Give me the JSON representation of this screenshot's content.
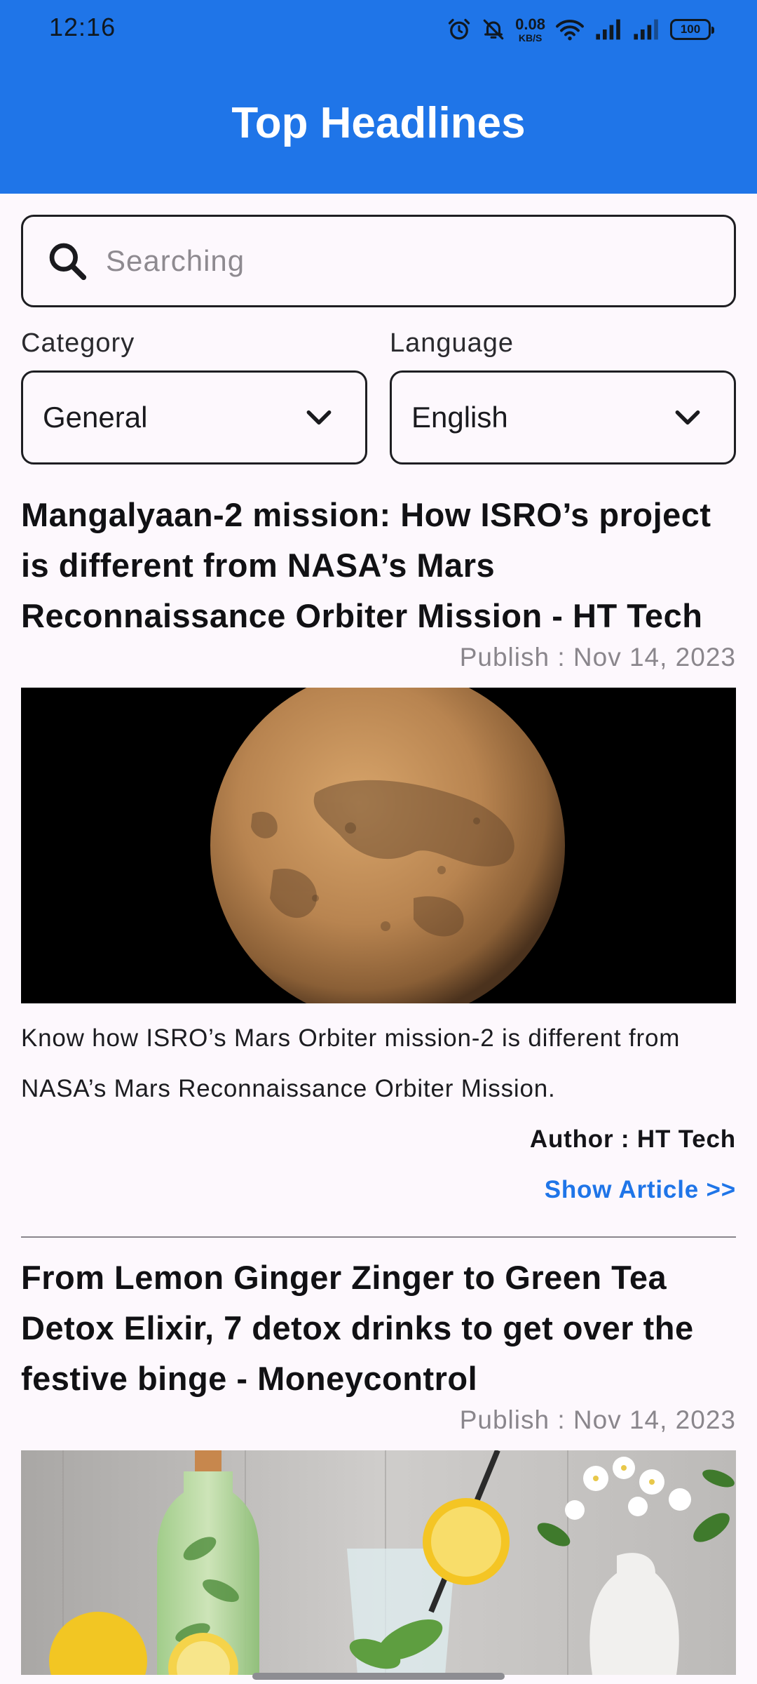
{
  "status_bar": {
    "time": "12:16",
    "net_speed_value": "0.08",
    "net_speed_unit": "KB/S",
    "battery": "100",
    "icons": [
      "alarm-icon",
      "mute-icon",
      "wifi-icon",
      "signal-icon",
      "signal-icon",
      "battery-icon"
    ]
  },
  "app_bar": {
    "title": "Top Headlines",
    "color": "#1f75e8"
  },
  "search": {
    "placeholder": "Searching",
    "value": ""
  },
  "filters": {
    "category_label": "Category",
    "category_value": "General",
    "language_label": "Language",
    "language_value": "English"
  },
  "articles": [
    {
      "title": "Mangalyaan-2 mission: How ISRO’s project is different from NASA’s Mars Reconnaissance Orbiter Mission - HT Tech",
      "publish": "Publish : Nov 14, 2023",
      "description": "Know how ISRO’s Mars Orbiter mission-2 is different from NASA’s Mars Reconnaissance Orbiter Mission.",
      "author": "Author : HT Tech",
      "link_label": "Show Article >>"
    },
    {
      "title": "From Lemon Ginger Zinger to Green Tea Detox Elixir, 7 detox drinks to get over the festive binge - Moneycontrol",
      "publish": "Publish : Nov 14, 2023"
    }
  ]
}
